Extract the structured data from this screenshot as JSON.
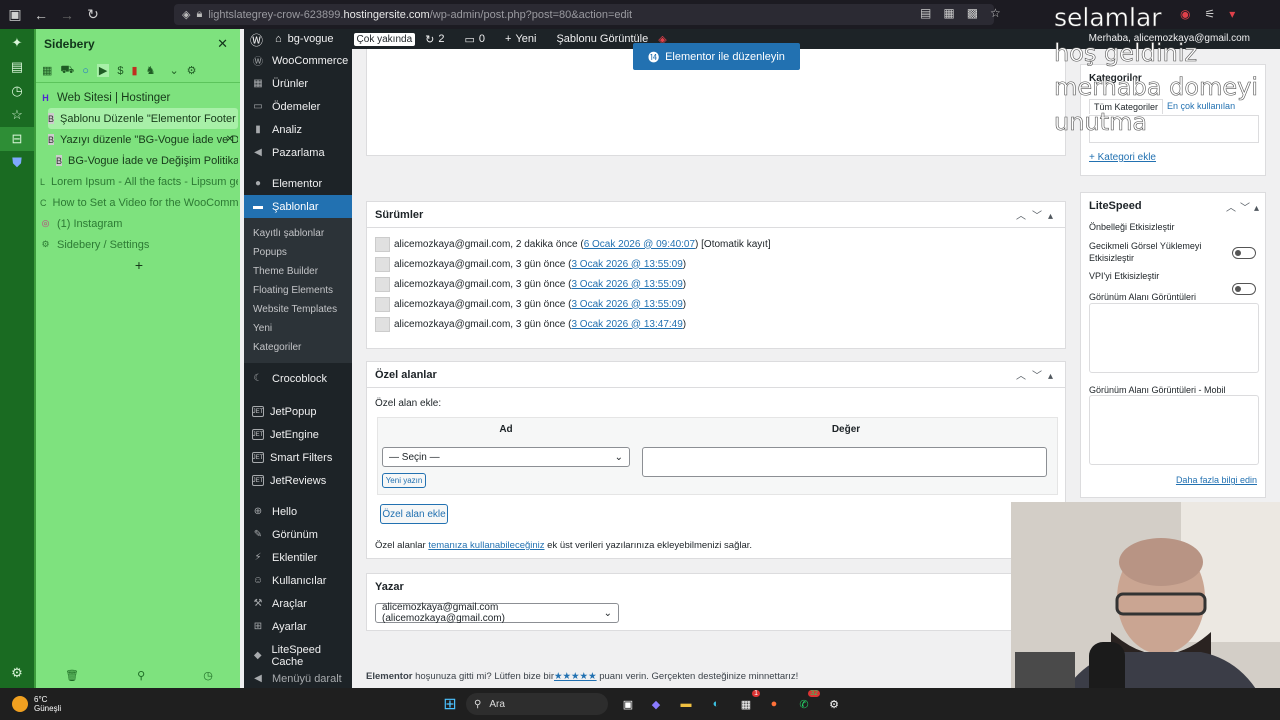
{
  "browser": {
    "url_prefix": "lightslategrey-crow-623899.",
    "url_host": "hostingersite.com",
    "url_path": "/wp-admin/post.php?post=80&action=edit"
  },
  "sidebery": {
    "title": "Sidebery",
    "tabs": [
      {
        "label": "Web Sitesi | Hostinger",
        "icon": "H"
      },
      {
        "label": "Şablonu Düzenle \"Elementor Footer #8",
        "icon": "B"
      },
      {
        "label": "Yazıyı düzenle \"BG-Vogue İade ve D",
        "icon": "B"
      },
      {
        "label": "BG-Vogue İade ve Değişim Politikası -",
        "icon": "B"
      },
      {
        "label": "Lorem Ipsum - All the facts - Lipsum ger",
        "icon": "L"
      },
      {
        "label": "How to Set a Video for the WooCommer",
        "icon": "C"
      },
      {
        "label": "(1) Instagram",
        "icon": "◎"
      },
      {
        "label": "Sidebery / Settings",
        "icon": "⚙"
      }
    ],
    "add_label": "+"
  },
  "adminbar": {
    "site_name": "bg-vogue",
    "badge": "Çok yakında",
    "updates": "2",
    "comments": "0",
    "new_label": "Yeni",
    "view_template": "Şablonu Görüntüle",
    "greeting": "Merhaba, alicemozkaya@gmail.com"
  },
  "menu": {
    "woocommerce": "WooCommerce",
    "products": "Ürünler",
    "payments": "Ödemeler",
    "analytics": "Analiz",
    "marketing": "Pazarlama",
    "elementor": "Elementor",
    "templates": "Şablonlar",
    "sub": [
      "Kayıtlı şablonlar",
      "Popups",
      "Theme Builder",
      "Floating Elements",
      "Website Templates",
      "Yeni",
      "Kategoriler"
    ],
    "crocoblock": "Crocoblock",
    "jetpopup": "JetPopup",
    "jetengine": "JetEngine",
    "smartfilters": "Smart Filters",
    "jetreviews": "JetReviews",
    "hello": "Hello",
    "appearance": "Görünüm",
    "plugins": "Eklentiler",
    "users": "Kullanıcılar",
    "tools": "Araçlar",
    "settings": "Ayarlar",
    "litespeed": "LiteSpeed Cache",
    "collapse": "Menüyü daralt"
  },
  "editor": {
    "elementor_button": "Elementor ile düzenleyin"
  },
  "revisions": {
    "title": "Sürümler",
    "rows": [
      {
        "author": "alicemozkaya@gmail.com, 2 dakika önce (",
        "link": "6 Ocak 2026 @ 09:40:07",
        "suffix": ") [Otomatik kayıt]"
      },
      {
        "author": "alicemozkaya@gmail.com, 3 gün önce (",
        "link": "3 Ocak 2026 @ 13:55:09",
        "suffix": ")"
      },
      {
        "author": "alicemozkaya@gmail.com, 3 gün önce (",
        "link": "3 Ocak 2026 @ 13:55:09",
        "suffix": ")"
      },
      {
        "author": "alicemozkaya@gmail.com, 3 gün önce (",
        "link": "3 Ocak 2026 @ 13:55:09",
        "suffix": ")"
      },
      {
        "author": "alicemozkaya@gmail.com, 3 gün önce (",
        "link": "3 Ocak 2026 @ 13:47:49",
        "suffix": ")"
      }
    ]
  },
  "custom_fields": {
    "title": "Özel alanlar",
    "add_label": "Özel alan ekle:",
    "col_name": "Ad",
    "col_value": "Değer",
    "select_value": "— Seçin —",
    "new_button": "Yeni yazın",
    "add_button": "Özel alan ekle",
    "note_prefix": "Özel alanlar ",
    "note_link": "temanıza kullanabileceğiniz",
    "note_suffix": " ek üst verileri yazılarınıza ekleyebilmenizi sağlar."
  },
  "author_box": {
    "title": "Yazar",
    "selected": "alicemozkaya@gmail.com (alicemozkaya@gmail.com)"
  },
  "footer": {
    "brand": "Elementor",
    "text1": " hoşunuza gitti mi? Lütfen bize bir",
    "stars": "★★★★★",
    "text2": " puanı verin. Gerçekten desteğinize minnettarız!"
  },
  "categories": {
    "title": "Kategoriler",
    "tab_all": "Tüm Kategoriler",
    "tab_popular": "En çok kullanılan",
    "add_link": "+ Kategori ekle"
  },
  "litespeed_box": {
    "title": "LiteSpeed",
    "opt1": "Önbelleği Etkisizleştir",
    "opt2": "Gecikmeli Görsel Yüklemeyi Etkisizleştir",
    "opt3": "VPI'yi Etkisizleştir",
    "label1": "Görünüm Alanı Görüntüleri",
    "label2": "Görünüm Alanı Görüntüleri - Mobil",
    "more_link": "Daha fazla bilgi edin"
  },
  "overlay": {
    "line1": "selamlar",
    "line2": "hoş geldiniz",
    "line3": "merhaba domeyi",
    "line4": "unutma"
  },
  "taskbar": {
    "weather_temp": "6°C",
    "weather_desc": "Güneşli",
    "search": "Ara",
    "badge1": "1",
    "badge2": "32"
  },
  "colors": {
    "sidebery_bg": "#7ee27e",
    "wp_dark": "#1d2327",
    "wp_blue": "#2271b1"
  }
}
